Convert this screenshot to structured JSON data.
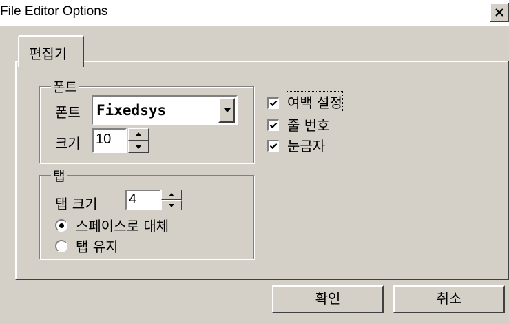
{
  "window": {
    "title": "File Editor Options"
  },
  "tabs": [
    {
      "label": "편집기"
    }
  ],
  "font_group": {
    "label": "폰트",
    "font_label": "폰트",
    "font_value": "Fixedsys",
    "size_label": "크기",
    "size_value": "10"
  },
  "tab_group": {
    "label": "탭",
    "size_label": "탭 크기",
    "size_value": "4",
    "options": [
      {
        "label": "스페이스로 대체",
        "selected": true
      },
      {
        "label": "탭 유지",
        "selected": false
      }
    ]
  },
  "checkboxes": [
    {
      "label": "여백 설정",
      "checked": true
    },
    {
      "label": "줄 번호",
      "checked": true
    },
    {
      "label": "눈금자",
      "checked": true
    }
  ],
  "buttons": {
    "ok": "확인",
    "cancel": "취소"
  }
}
